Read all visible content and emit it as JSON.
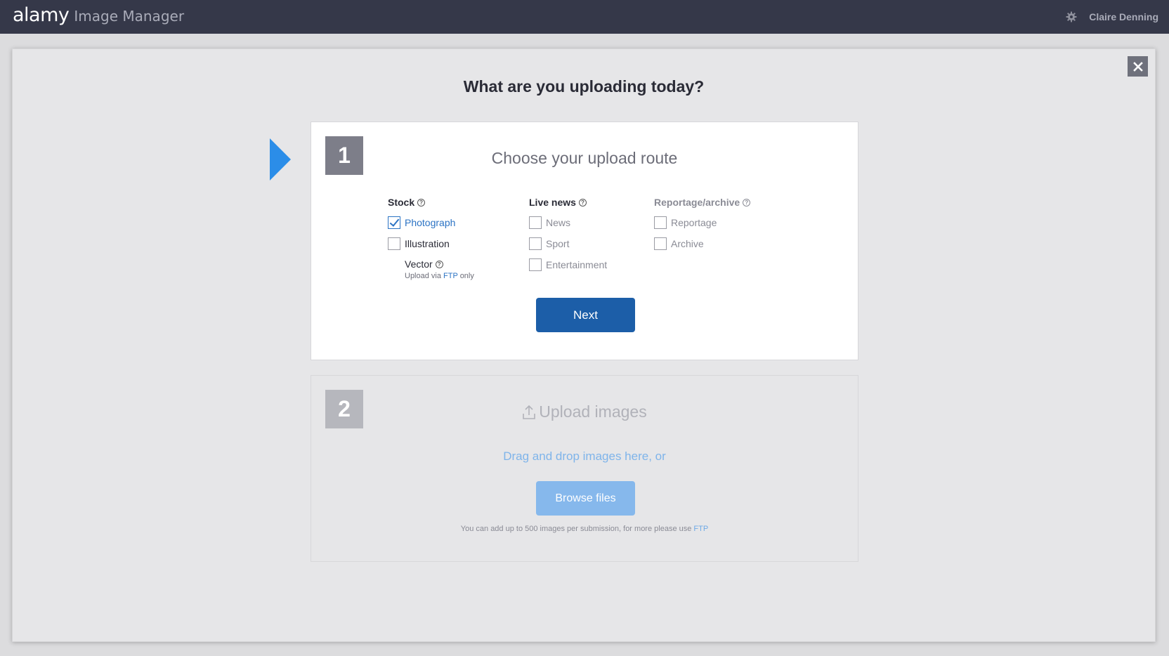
{
  "header": {
    "logo": "alamy",
    "product": "Image Manager",
    "user_name": "Claire Denning",
    "settings_icon": "gear-icon"
  },
  "modal": {
    "title": "What are you uploading today?",
    "close_icon": "close-icon"
  },
  "step1": {
    "number": "1",
    "heading": "Choose your upload route",
    "columns": {
      "stock": {
        "title": "Stock",
        "options": [
          {
            "label": "Photograph",
            "checked": true
          },
          {
            "label": "Illustration",
            "checked": false
          }
        ],
        "vector": {
          "label": "Vector",
          "note_prefix": "Upload via",
          "note_link": "FTP",
          "note_suffix": "only"
        }
      },
      "live_news": {
        "title": "Live news",
        "options": [
          {
            "label": "News",
            "checked": false
          },
          {
            "label": "Sport",
            "checked": false
          },
          {
            "label": "Entertainment",
            "checked": false
          }
        ]
      },
      "reportage": {
        "title": "Reportage/archive",
        "options": [
          {
            "label": "Reportage",
            "checked": false
          },
          {
            "label": "Archive",
            "checked": false
          }
        ]
      }
    },
    "next_label": "Next"
  },
  "step2": {
    "number": "2",
    "heading": "Upload images",
    "drag_text": "Drag and drop images here, or",
    "browse_label": "Browse files",
    "limit_text": "You can add up to 500 images per submission, for more please use",
    "limit_link": "FTP"
  },
  "colors": {
    "topbar": "#353849",
    "accent_arrow": "#2b8de8",
    "primary_button": "#1c5ea8",
    "disabled_button": "#86b8ec",
    "link": "#2b73c4"
  }
}
